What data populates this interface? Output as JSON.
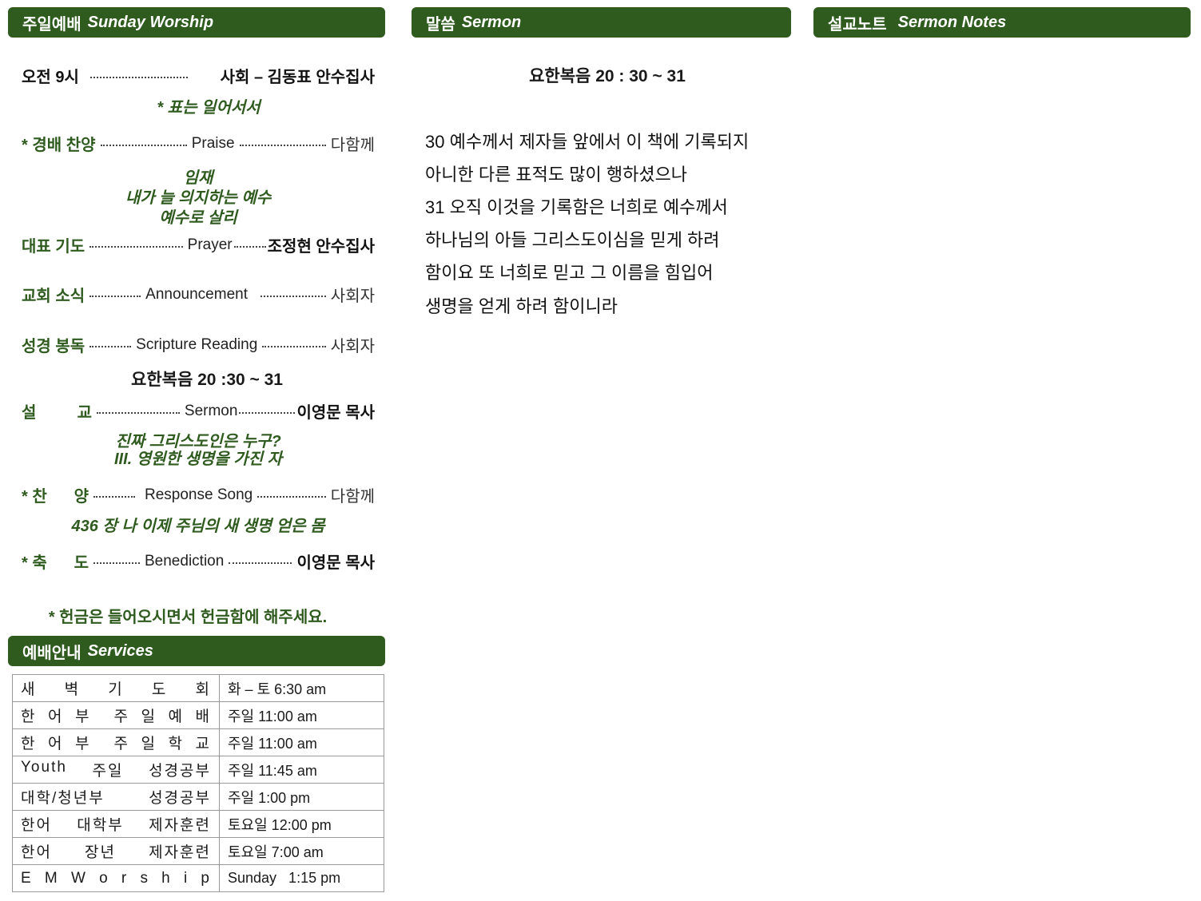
{
  "colors": {
    "header_bg": "#2f5b1f",
    "accent_text": "#2f5b1f"
  },
  "worship": {
    "header_ko": "주일예배",
    "header_en": "Sunday Worship",
    "time": "오전 9시",
    "leader": "사회 – 김동표 안수집사",
    "stand_note": "* 표는 일어서서",
    "praise": {
      "label": "* 경배 찬양",
      "mid": "Praise",
      "right": "다함께"
    },
    "praise_songs": [
      "임재",
      "내가 늘 의지하는 예수",
      "예수로 살리"
    ],
    "prayer": {
      "label": "대표 기도",
      "mid": "Prayer",
      "right": "조정현 안수집사"
    },
    "announce": {
      "label": "교회 소식",
      "mid": "Announcement",
      "right": "사회자"
    },
    "scripture": {
      "label": "성경 봉독",
      "mid": "Scripture Reading",
      "right": "사회자"
    },
    "scripture_ref": "요한복음 20 :30 ~ 31",
    "sermon": {
      "label_a": "설",
      "label_b": "교",
      "mid": "Sermon",
      "right": "이영문 목사"
    },
    "sermon_title": [
      "진짜 그리스도인은 누구?",
      "III. 영원한 생명을 가진 자"
    ],
    "response": {
      "label_a": "* 찬",
      "label_b": "양",
      "mid": "Response Song",
      "right": "다함께"
    },
    "hymn": "436 장 나 이제 주님의 새 생명 얻은 몸",
    "benediction": {
      "label_a": "* 축",
      "label_b": "도",
      "mid": "Benediction",
      "right": "이영문 목사"
    },
    "offering_note": "* 헌금은 들어오시면서 헌금함에 해주세요."
  },
  "services": {
    "header_ko": "예배안내",
    "header_en": "Services",
    "rows": [
      {
        "name": [
          "새",
          "벽",
          "기",
          "도",
          "회"
        ],
        "time": "화 – 토 6:30 am"
      },
      {
        "name": [
          "한",
          "어",
          "부",
          "",
          "주",
          "일",
          "예",
          "배"
        ],
        "time": "주일 11:00 am"
      },
      {
        "name": [
          "한",
          "어",
          "부",
          "",
          "주",
          "일",
          "학",
          "교"
        ],
        "time": "주일 11:00 am"
      },
      {
        "name": [
          "Youth",
          "주일",
          "성경공부"
        ],
        "time": "주일 11:45 am"
      },
      {
        "name": [
          "대학/청년부",
          "성경공부"
        ],
        "time": "주일 1:00 pm"
      },
      {
        "name": [
          "한어",
          "대학부",
          "제자훈련"
        ],
        "time": "토요일 12:00 pm"
      },
      {
        "name": [
          "한어",
          "장년",
          "제자훈련"
        ],
        "time": "토요일 7:00 am"
      },
      {
        "name": [
          "E",
          "M",
          "W",
          "o",
          "r",
          "s",
          "h",
          "i",
          "p"
        ],
        "time": "Sunday   1:15 pm"
      }
    ]
  },
  "sermon": {
    "header_ko": "말씀",
    "header_en": "Sermon",
    "reference": "요한복음 20 : 30 ~ 31",
    "lines": [
      "30 예수께서 제자들 앞에서 이 책에 기록되지",
      "아니한 다른 표적도 많이 행하셨으나",
      "31 오직 이것을 기록함은 너희로 예수께서",
      "하나님의 아들 그리스도이심을 믿게 하려",
      "함이요 또 너희로 믿고 그 이름을 힘입어",
      "생명을 얻게 하려 함이니라"
    ]
  },
  "notes": {
    "header_ko": "설교노트",
    "header_en": "Sermon Notes"
  }
}
